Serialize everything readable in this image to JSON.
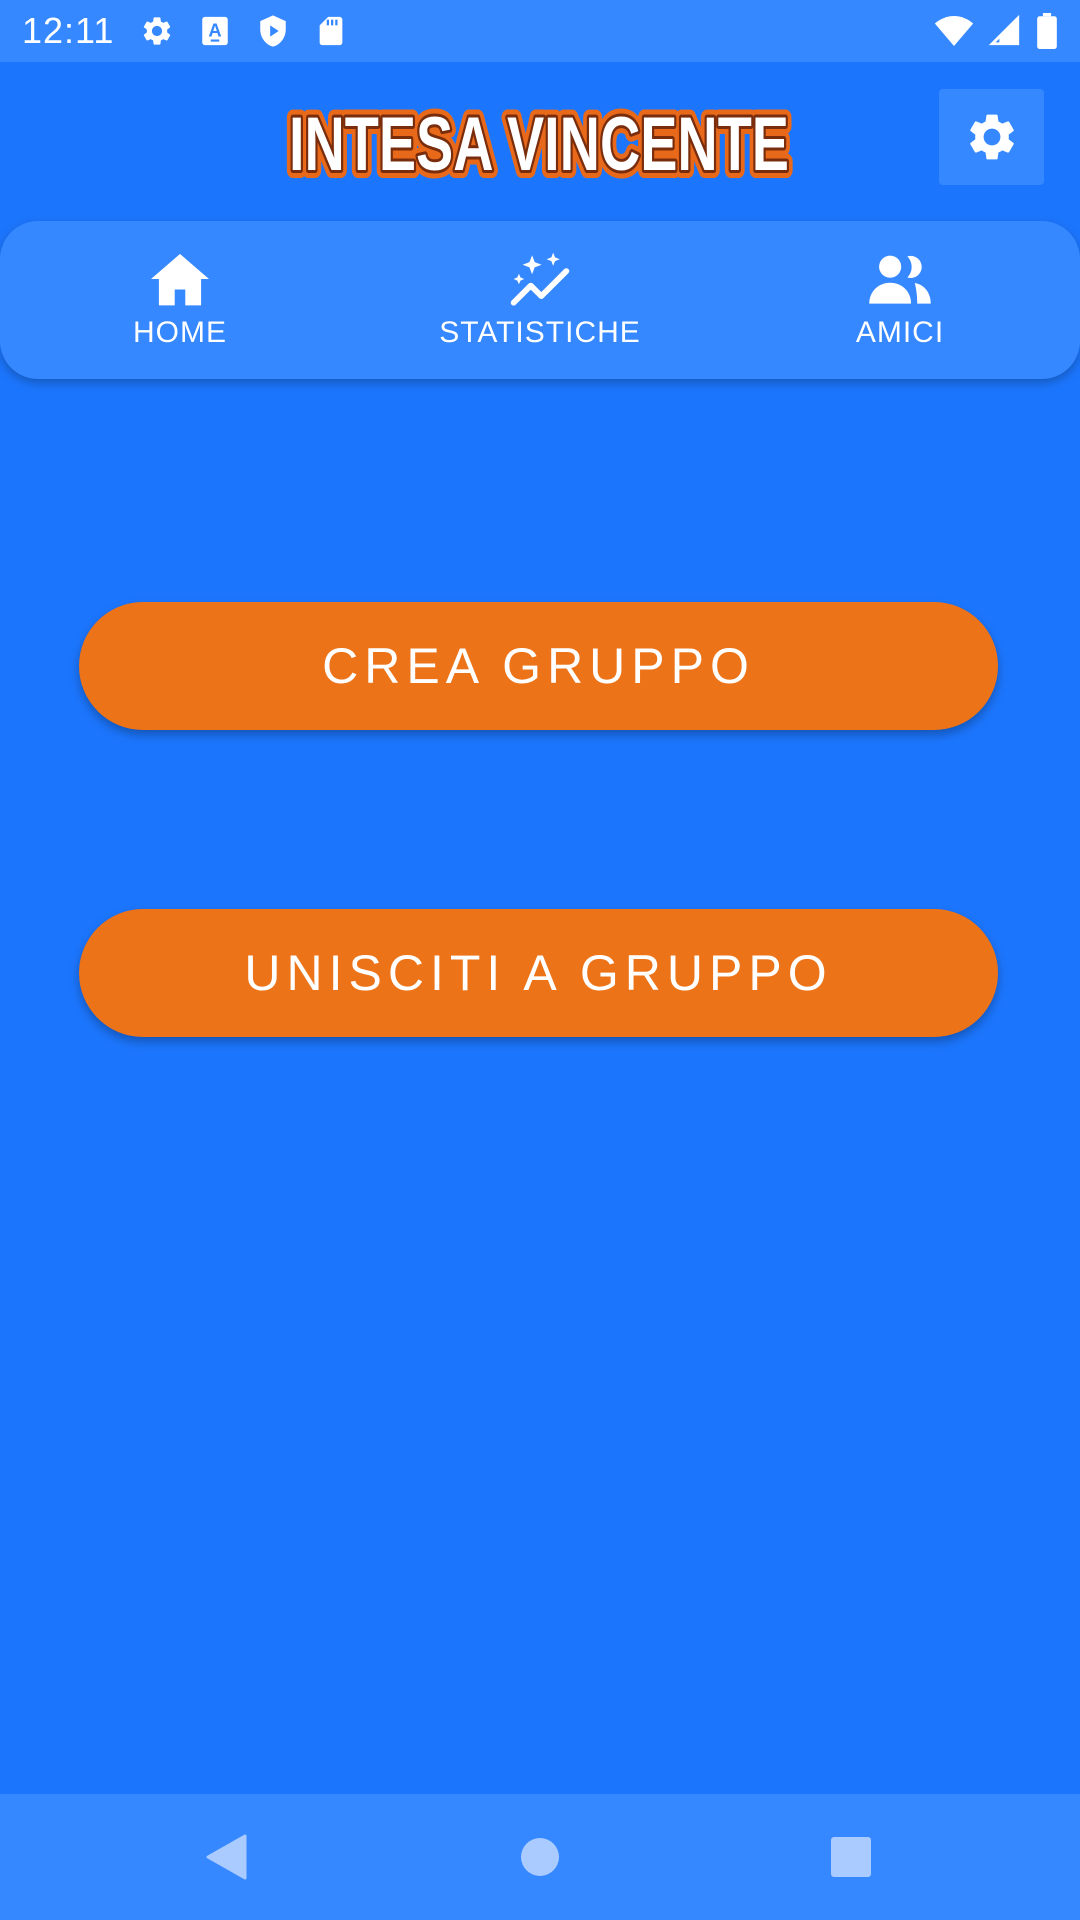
{
  "status_bar": {
    "time": "12:11",
    "icons_left": [
      "settings-icon",
      "keyboard-a-icon",
      "play-protect-icon",
      "sd-card-icon"
    ],
    "icons_right": [
      "wifi-icon",
      "signal-icon",
      "battery-icon"
    ]
  },
  "header": {
    "logo_text": "INTESA VINCENTE",
    "settings_icon": "gear-icon"
  },
  "tabs": [
    {
      "label": "HOME",
      "icon": "home-icon"
    },
    {
      "label": "STATISTICHE",
      "icon": "stats-sparkle-icon"
    },
    {
      "label": "AMICI",
      "icon": "friends-icon"
    }
  ],
  "actions": {
    "create_group": "CREA GRUPPO",
    "join_group": "UNISCITI A GRUPPO"
  },
  "nav_bar": {
    "icons": [
      "back-icon",
      "home-circle-icon",
      "recents-icon"
    ]
  },
  "colors": {
    "background": "#1c76fd",
    "bar": "#3588ff",
    "accent_orange": "#ed7318",
    "logo_orange": "#e8691a",
    "logo_dark": "#7a2d0c"
  }
}
